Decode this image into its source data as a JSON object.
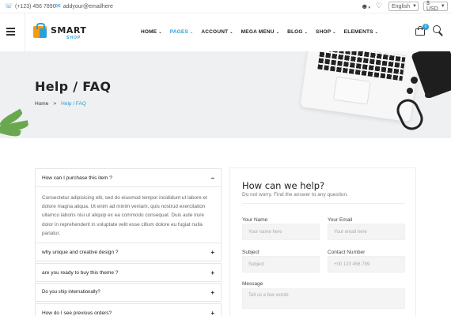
{
  "topbar": {
    "phone": "(+123) 456 7890",
    "email": "addyour@emailhere",
    "language": "English",
    "currency": "$ USD"
  },
  "header": {
    "logo_main": "SMART",
    "logo_sub": "SHOP",
    "nav": [
      {
        "label": "HOME",
        "caret": true,
        "active": false
      },
      {
        "label": "PAGES",
        "caret": true,
        "active": true
      },
      {
        "label": "ACCOUNT",
        "caret": true,
        "active": false
      },
      {
        "label": "MEGA MENU",
        "caret": true,
        "active": false
      },
      {
        "label": "BLOG",
        "caret": true,
        "active": false
      },
      {
        "label": "SHOP",
        "caret": true,
        "active": false
      },
      {
        "label": "ELEMENTS",
        "caret": true,
        "active": false
      }
    ],
    "cart_count": "0"
  },
  "hero": {
    "title": "Help / FAQ",
    "breadcrumb_home": "Home",
    "breadcrumb_sep": ">",
    "breadcrumb_current": "Help / FAQ"
  },
  "faq": {
    "items": [
      {
        "question": "How can I purchase this item ?",
        "sign": "−",
        "open": true,
        "answer": "Consectetur adipisicing elit, sed do eiusmod tempor incididunt ut labore et dolore magna aliqua. Ut enim ad minim veniam, quis nostrud exercitation ullamco laboris nisi ut aliquip ex ea commodo consequat. Duis aute irure dolor in reprehenderit in voluptate velit esse cillum dolore eu fugiat nulla pariatur."
      },
      {
        "question": "why unique and creative design ?",
        "sign": "+",
        "open": false
      },
      {
        "question": "are you ready to buy this theme ?",
        "sign": "+",
        "open": false
      },
      {
        "question": "Do you ship internationally?",
        "sign": "+",
        "open": false
      },
      {
        "question": "How do I see previous orders?",
        "sign": "+",
        "open": false
      }
    ]
  },
  "contact": {
    "title": "How can we help?",
    "subtitle": "Do not worry. Find the answer to any question.",
    "name_label": "Your Name",
    "name_placeholder": "Your name here",
    "email_label": "Your Email",
    "email_placeholder": "Your email here",
    "subject_label": "Subject",
    "subject_placeholder": "Subject",
    "phone_label": "Contact Number",
    "phone_placeholder": "+00 123 456 789",
    "message_label": "Message",
    "message_placeholder": "Tell us a few words"
  }
}
